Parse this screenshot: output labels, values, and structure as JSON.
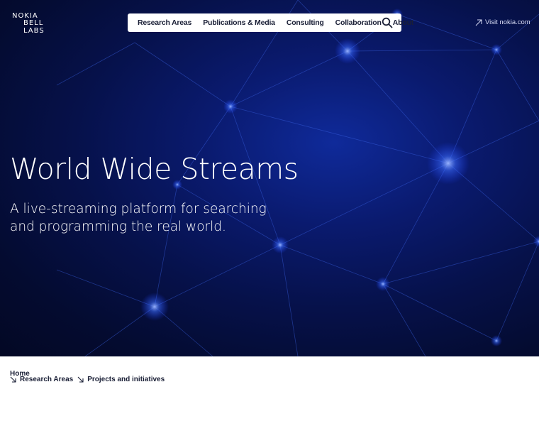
{
  "logo": {
    "line1": "NOKIA",
    "line2": "BELL LABS"
  },
  "nav": {
    "items": [
      "Research Areas",
      "Publications & Media",
      "Consulting",
      "Collaboration",
      "About"
    ],
    "search_icon": "search-icon"
  },
  "visit_link": {
    "label": "Visit nokia.com",
    "icon": "external-arrow-icon"
  },
  "hero": {
    "title": "World Wide Streams",
    "subtitle": "A live-streaming platform for searching and programming the real world."
  },
  "breadcrumb": {
    "home": "Home",
    "items": [
      "Research Areas",
      "Projects and initiatives"
    ]
  },
  "colors": {
    "hero_bg": "#06114a",
    "accent": "#2a5cff",
    "text_dark": "#1a1f36"
  }
}
